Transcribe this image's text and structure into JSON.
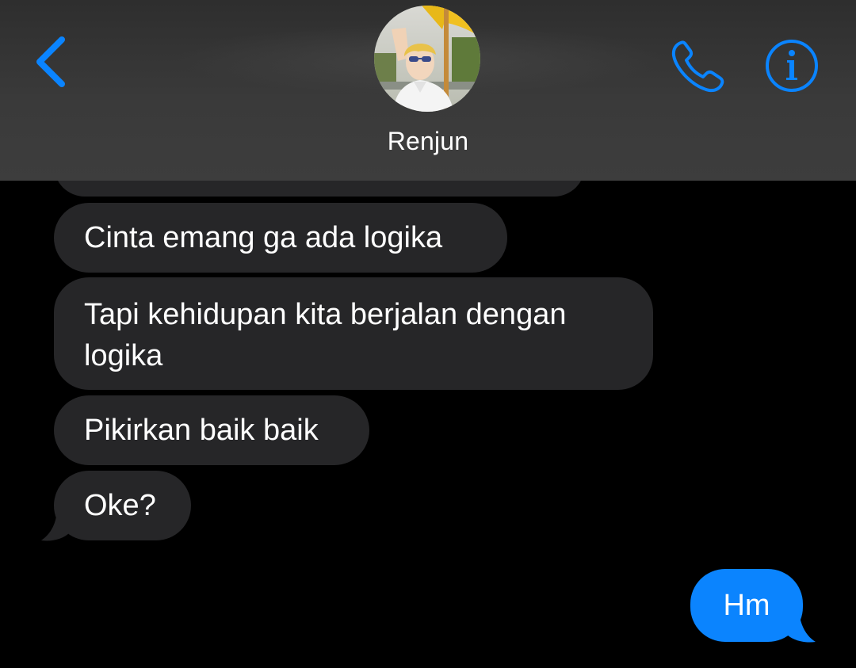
{
  "header": {
    "contact_name": "Renjun",
    "back_icon": "chevron-left-icon",
    "call_icon": "phone-icon",
    "info_icon": "info-icon",
    "accent_color": "#0a84ff"
  },
  "messages": {
    "incoming": [
      "Cinta emang ga ada logika",
      "Tapi kehidupan kita berjalan dengan logika",
      "Pikirkan baik baik",
      "Oke?"
    ],
    "outgoing": [
      "Hm"
    ]
  },
  "colors": {
    "incoming_bubble": "#262628",
    "outgoing_bubble": "#0b84fe",
    "background": "#000000"
  }
}
